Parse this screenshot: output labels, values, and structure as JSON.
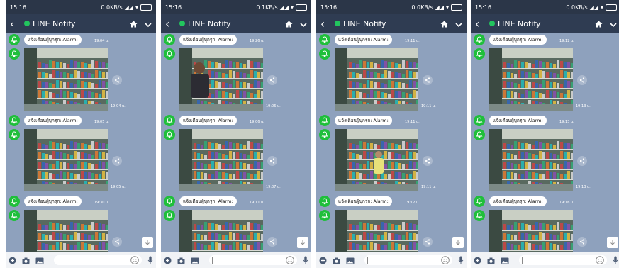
{
  "app": {
    "title": "LINE Notify",
    "message_text": "แจ้งเตือนผู้บุกรุก: Alarm:"
  },
  "colors": {
    "header": "#2f3c52",
    "status": "#2b3648",
    "chat_bg": "#8ea1bd",
    "bell": "#1fbf3b"
  },
  "icons": [
    "back-icon",
    "home-icon",
    "chevron-down-icon",
    "bell-icon",
    "share-icon",
    "scroll-down-icon",
    "add-icon",
    "camera-icon",
    "image-icon",
    "emoji-icon",
    "mic-icon"
  ],
  "panels": [
    {
      "status_time": "15:16",
      "status_net": "0.0KB/s",
      "messages": [
        {
          "time": "19:04 u.",
          "photo_time": "19:04 u."
        },
        {
          "time": "19:05 u.",
          "photo_time": "19:05 u."
        },
        {
          "time": "19:30 u."
        }
      ]
    },
    {
      "status_time": "15:16",
      "status_net": "0.1KB/s",
      "messages": [
        {
          "time": "19:26 u.",
          "photo_time": "19:06 u."
        },
        {
          "time": "19:06 u.",
          "photo_time": "19:07 u."
        },
        {
          "time": "19:11 u."
        }
      ]
    },
    {
      "status_time": "15:16",
      "status_net": "0.0KB/s",
      "messages": [
        {
          "time": "19:11 u.",
          "photo_time": "19:11 u."
        },
        {
          "time": "19:11 u.",
          "photo_time": "19:11 u."
        },
        {
          "time": "19:12 u."
        }
      ]
    },
    {
      "status_time": "15:16",
      "status_net": "0.0KB/s",
      "messages": [
        {
          "time": "19:12 u.",
          "photo_time": "19:13 u."
        },
        {
          "time": "19:13 u.",
          "photo_time": "19:13 u."
        },
        {
          "time": "19:16 u."
        }
      ]
    }
  ]
}
